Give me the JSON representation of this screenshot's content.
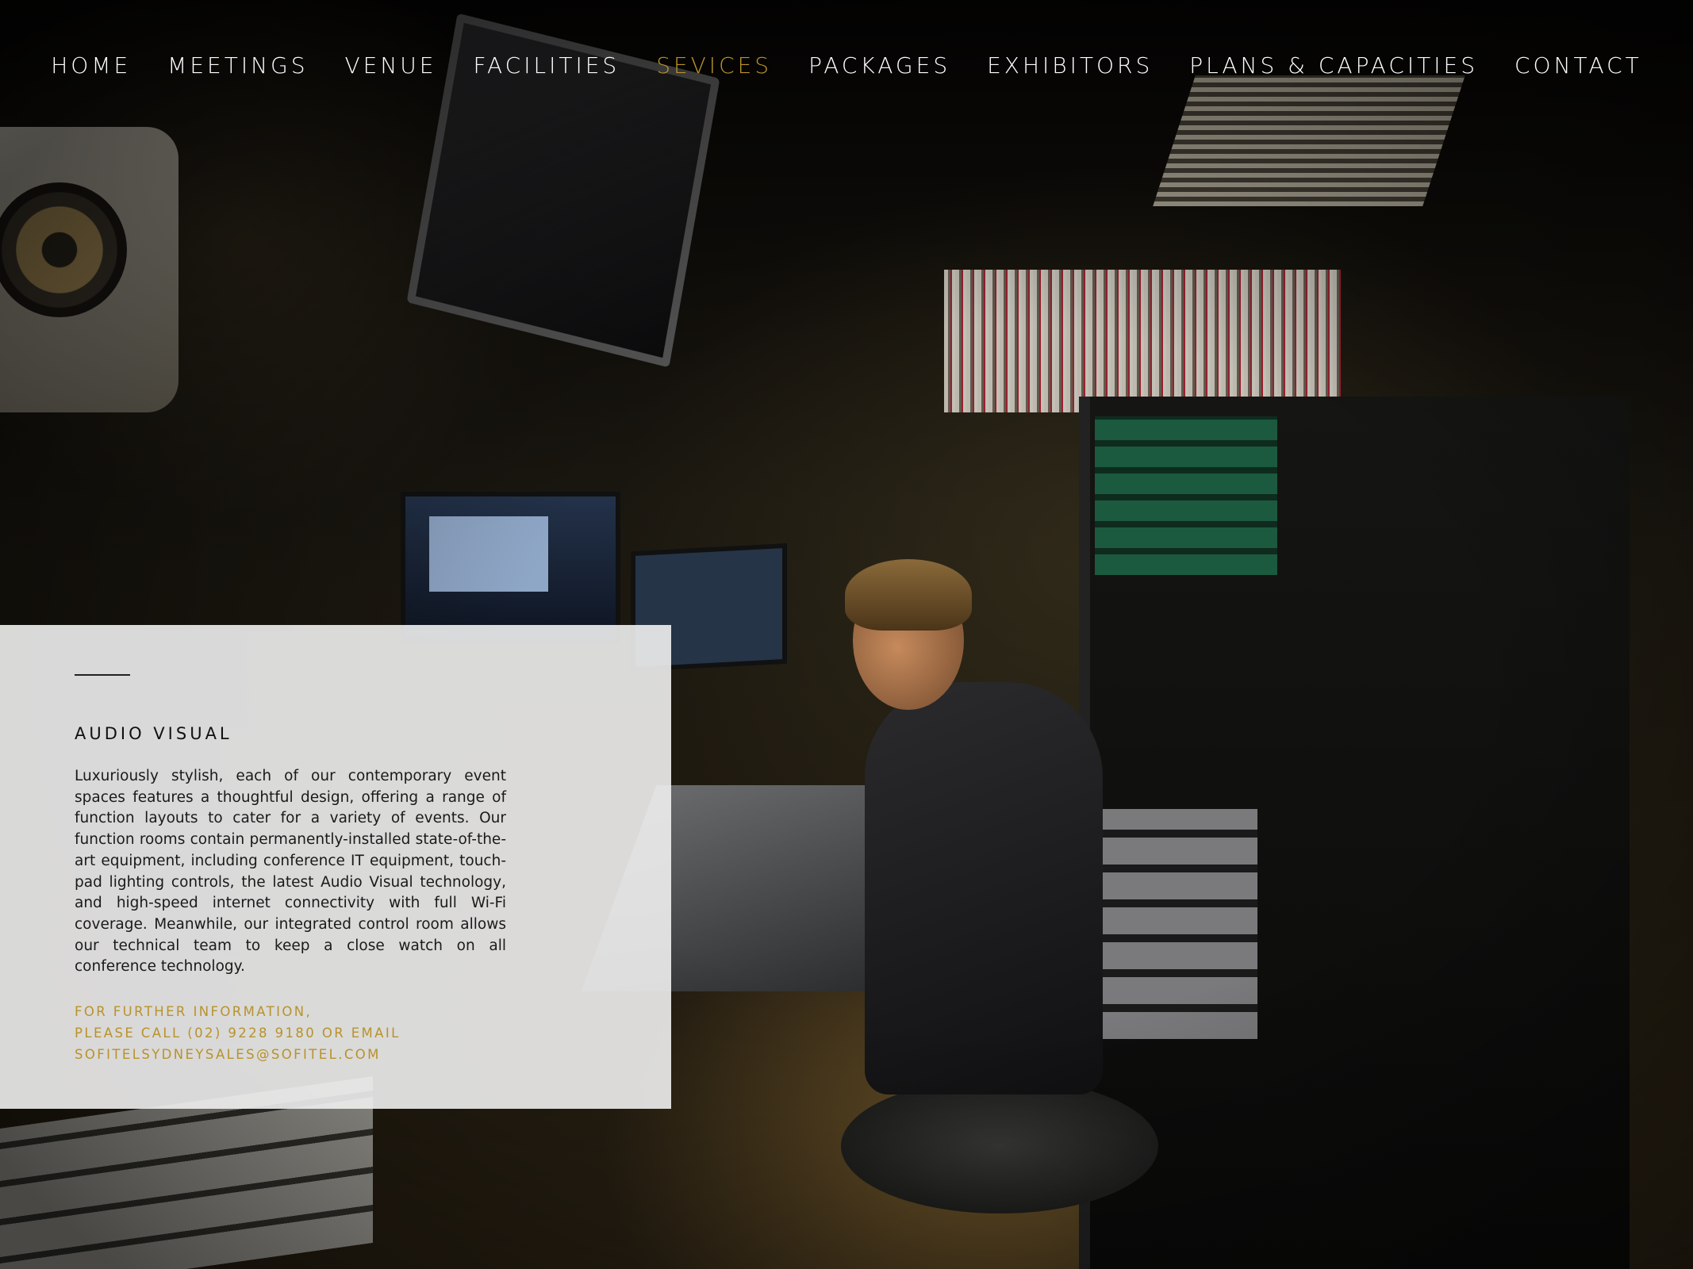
{
  "nav": {
    "items": [
      {
        "label": "HOME"
      },
      {
        "label": "MEETINGS"
      },
      {
        "label": "VENUE"
      },
      {
        "label": "FACILITIES"
      },
      {
        "label": "SEVICES",
        "active": true
      },
      {
        "label": "PACKAGES"
      },
      {
        "label": "EXHIBITORS"
      },
      {
        "label": "PLANS & CAPACITIES"
      },
      {
        "label": "CONTACT"
      }
    ],
    "active_color": "#b8922b",
    "text_color": "#ffffff"
  },
  "panel": {
    "title": "AUDIO VISUAL",
    "body": "Luxuriously stylish, each of our contemporary event spaces features a thoughtful design, offering a range of function layouts to cater for a variety of events. Our function rooms contain permanently-installed state-of-the-art equipment, including conference IT equipment, touch-pad lighting controls, the latest Audio Visual technology, and high-speed internet connectivity with full Wi-Fi coverage. Meanwhile, our integrated control room allows our technical team to keep a close watch on all conference technology.",
    "contact_lines": [
      "FOR FURTHER INFORMATION,",
      "PLEASE CALL (02) 9228 9180 OR EMAIL",
      "SOFITELSYDNEYSALES@SOFITEL.COM"
    ],
    "accent_color": "#b8922b"
  }
}
